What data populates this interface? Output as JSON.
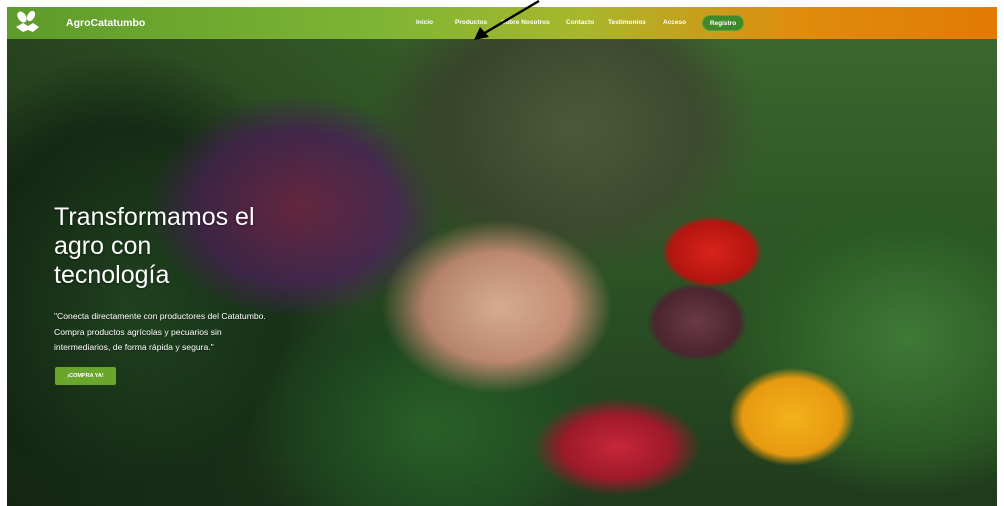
{
  "navbar": {
    "brand": "AgroCatatumbo",
    "items": [
      "Inicio",
      "Productos",
      "Sobre Nosotros",
      "Contacto",
      "Testimonios",
      "Acceso"
    ],
    "register_label": "Registro"
  },
  "hero": {
    "title_lines": [
      "Transformamos el",
      "agro con",
      "tecnología"
    ],
    "description": "\"Conecta directamente con productores del Catatumbo. Compra productos agrícolas y pecuarios sin intermediarios, de forma rápida y segura.\"",
    "cta_label": "¡COMPRA YA!"
  },
  "colors": {
    "navbar_start": "#5e9b2b",
    "navbar_end": "#e27a05",
    "register_bg": "#3e8a2a",
    "cta_bg": "#6aa62c"
  },
  "icons": {
    "logo": "handshake-leaf-logo",
    "annotation": "arrow-icon"
  }
}
